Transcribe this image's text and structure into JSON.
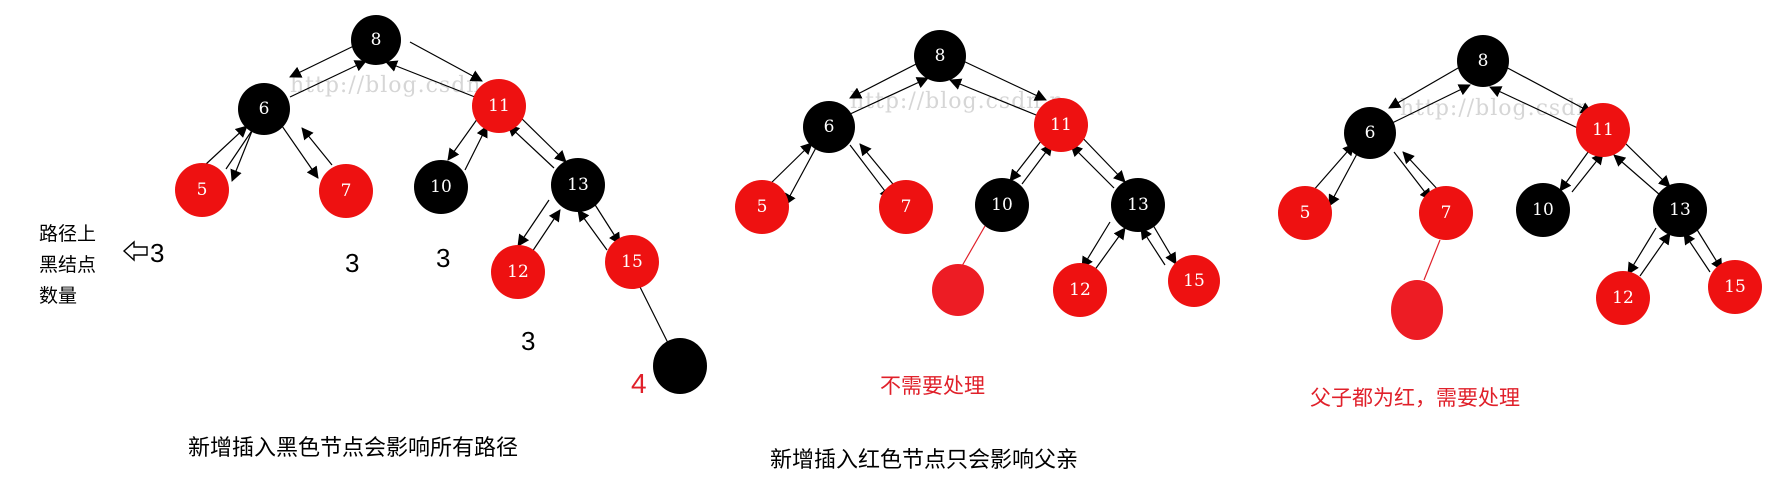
{
  "colors": {
    "black_node": "#000000",
    "red_node": "#ee1111",
    "red_text": "#e0202a"
  },
  "watermark": "http://blog.csdn.n",
  "panels": [
    {
      "nodes": {
        "n8": "8",
        "n6": "6",
        "n11": "11",
        "n5": "5",
        "n7": "7",
        "n10": "10",
        "n13": "13",
        "n12": "12",
        "n15": "15"
      },
      "path_counts": [
        "3",
        "3",
        "3",
        "3"
      ],
      "new_count": "4",
      "side_label": [
        "路径上",
        "黑结点",
        "数量"
      ],
      "caption": "新增插入黑色节点会影响所有路径"
    },
    {
      "nodes": {
        "n8": "8",
        "n6": "6",
        "n11": "11",
        "n5": "5",
        "n7": "7",
        "n10": "10",
        "n13": "13",
        "n12": "12",
        "n15": "15"
      },
      "note": "不需要处理",
      "caption": "新增插入红色节点只会影响父亲"
    },
    {
      "nodes": {
        "n8": "8",
        "n6": "6",
        "n11": "11",
        "n5": "5",
        "n7": "7",
        "n10": "10",
        "n13": "13",
        "n12": "12",
        "n15": "15"
      },
      "note": "父子都为红，需要处理"
    }
  ]
}
